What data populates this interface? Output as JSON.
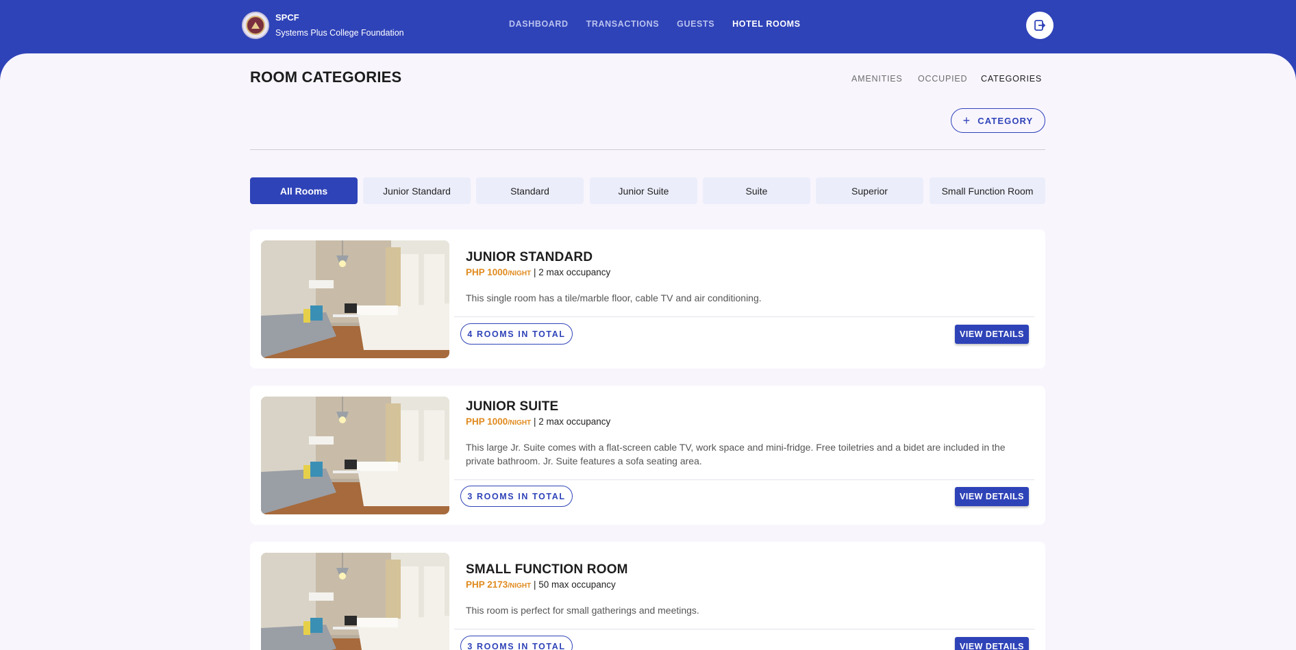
{
  "header": {
    "brand_short": "SPCF",
    "brand_full": "Systems Plus College Foundation",
    "nav": [
      {
        "label": "DASHBOARD",
        "active": false
      },
      {
        "label": "TRANSACTIONS",
        "active": false
      },
      {
        "label": "GUESTS",
        "active": false
      },
      {
        "label": "HOTEL ROOMS",
        "active": true
      }
    ],
    "logout_icon": "logout-icon"
  },
  "page": {
    "title": "ROOM CATEGORIES",
    "subnav": [
      {
        "label": "AMENITIES",
        "active": false
      },
      {
        "label": "OCCUPIED",
        "active": false
      },
      {
        "label": "CATEGORIES",
        "active": true
      }
    ],
    "add_button": {
      "icon": "+",
      "label": "CATEGORY"
    }
  },
  "filters": [
    {
      "label": "All Rooms",
      "active": true
    },
    {
      "label": "Junior Standard",
      "active": false
    },
    {
      "label": "Standard",
      "active": false
    },
    {
      "label": "Junior Suite",
      "active": false
    },
    {
      "label": "Suite",
      "active": false
    },
    {
      "label": "Superior",
      "active": false
    },
    {
      "label": "Small Function Room",
      "active": false
    }
  ],
  "rooms": [
    {
      "title": "JUNIOR STANDARD",
      "price": "PHP 1000",
      "per": "/NIGHT",
      "occupancy": "| 2 max occupancy",
      "description": "This single room has a tile/marble floor, cable TV and air conditioning.",
      "rooms_total": "4 ROOMS IN TOTAL",
      "action": "VIEW DETAILS"
    },
    {
      "title": "JUNIOR SUITE",
      "price": "PHP 1000",
      "per": "/NIGHT",
      "occupancy": "| 2 max occupancy",
      "description": "This large Jr. Suite comes with a flat-screen cable TV, work space and mini-fridge. Free toiletries and a bidet are included in the private bathroom. Jr. Suite features a sofa seating area.",
      "rooms_total": "3 ROOMS IN TOTAL",
      "action": "VIEW DETAILS"
    },
    {
      "title": "SMALL FUNCTION ROOM",
      "price": "PHP 2173",
      "per": "/NIGHT",
      "occupancy": "| 50 max occupancy",
      "description": "This room is perfect for small gatherings and meetings.",
      "rooms_total": "3 ROOMS IN TOTAL",
      "action": "VIEW DETAILS"
    }
  ],
  "colors": {
    "primary": "#2f43b8",
    "price": "#e08a1e",
    "background": "#f8f5fd"
  }
}
